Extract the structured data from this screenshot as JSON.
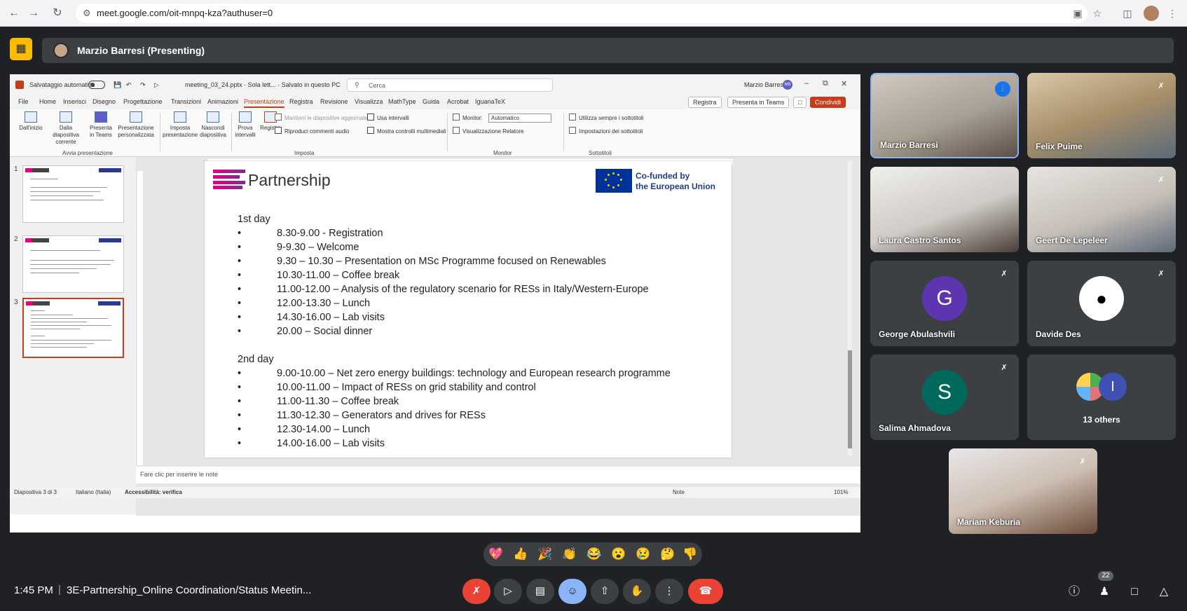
{
  "browser": {
    "url": "meet.google.com/oit-mnpq-kza?authuser=0"
  },
  "meet": {
    "presenter_label": "Marzio Barresi (Presenting)",
    "time": "1:45 PM",
    "meeting_title": "3E-Partnership_Online Coordination/Status Meetin...",
    "participant_count": "22"
  },
  "ppt": {
    "autosave_label": "Salvataggio automatico",
    "file_title": "meeting_03_24.pptx · Sola lett... · Salvato in questo PC",
    "search_placeholder": "Cerca",
    "user_name": "Marzio Barresi",
    "user_initials": "MB",
    "menus": [
      "File",
      "Home",
      "Inserisci",
      "Disegno",
      "Progettazione",
      "Transizioni",
      "Animazioni",
      "Presentazione",
      "Registra",
      "Revisione",
      "Visualizza",
      "MathType",
      "Guida",
      "Acrobat",
      "IguanaTeX"
    ],
    "record_btn": "Registra",
    "teams_btn": "Presenta in Teams",
    "share_btn": "Condividi",
    "ribbon": {
      "from_start": "Dall'inizio",
      "from_current": "Dalla diapositiva corrente",
      "present_teams": "Presenta in Teams",
      "custom_show": "Presentazione personalizzata",
      "group_start": "Avvia presentazione",
      "setup": "Imposta presentazione",
      "hide_slide": "Nascondi diapositiva",
      "rehearse": "Prova intervalli",
      "record": "Registra",
      "keep_updated": "Mantieni le diapositive aggiornate",
      "play_narrations": "Riproduci commenti audio",
      "use_timings": "Usa intervalli",
      "show_media": "Mostra controlli multimediali",
      "group_setup": "Imposta",
      "monitor_label": "Monitor:",
      "monitor_value": "Automatico",
      "presenter_view": "Visualizzazione Relatore",
      "group_monitor": "Monitor",
      "always_subtitles": "Utilizza sempre i sottotitoli",
      "subtitle_settings": "Impostazioni dei sottotitoli",
      "group_subtitles": "Sottotitoli"
    },
    "slide_numbers": [
      "1",
      "2",
      "3"
    ],
    "notes_placeholder": "Fare clic per inserire le note",
    "status": {
      "slide_of": "Diapositiva 3 di 3",
      "language": "Italiano (Italia)",
      "accessibility": "Accessibilità: verifica",
      "notes": "Note",
      "zoom": "101%"
    }
  },
  "slide": {
    "logo_text": "Partnership",
    "eu_text_1": "Co-funded by",
    "eu_text_2": "the European Union",
    "day1_title": "1st day",
    "day1": [
      "8.30-9.00 - Registration",
      "9-9.30 – Welcome",
      "9.30 – 10.30 – Presentation on MSc Programme focused on Renewables",
      "10.30-11.00 – Coffee break",
      "11.00-12.00 – Analysis of the regulatory scenario for RESs in Italy/Western-Europe",
      "12.00-13.30 – Lunch",
      "14.30-16.00 – Lab visits",
      "20.00 – Social dinner"
    ],
    "day2_title": "2nd day",
    "day2": [
      "9.00-10.00 – Net zero energy buildings: technology and European research programme",
      "10.00-11.00 – Impact of RESs on grid stability and control",
      "11.00-11.30 – Coffee break",
      "11.30-12.30 – Generators and drives for RESs",
      "12.30-14.00 – Lunch",
      "14.00-16.00 – Lab visits"
    ],
    "bullet": "•"
  },
  "participants": [
    {
      "name": "Marzio Barresi"
    },
    {
      "name": "Felix Puime"
    },
    {
      "name": "Laura Castro Santos"
    },
    {
      "name": "Geert De Lepeleer"
    },
    {
      "name": "George Abulashvili",
      "initial": "G"
    },
    {
      "name": "Davide Des"
    },
    {
      "name": "Salima Ahmadova",
      "initial": "S"
    },
    {
      "name": "13 others",
      "initial": "I"
    },
    {
      "name": "Mariam Keburia"
    }
  ],
  "colors": {
    "accent": "#8ab4f8",
    "end_call": "#ea4335",
    "ppt_accent": "#c43e1c"
  }
}
